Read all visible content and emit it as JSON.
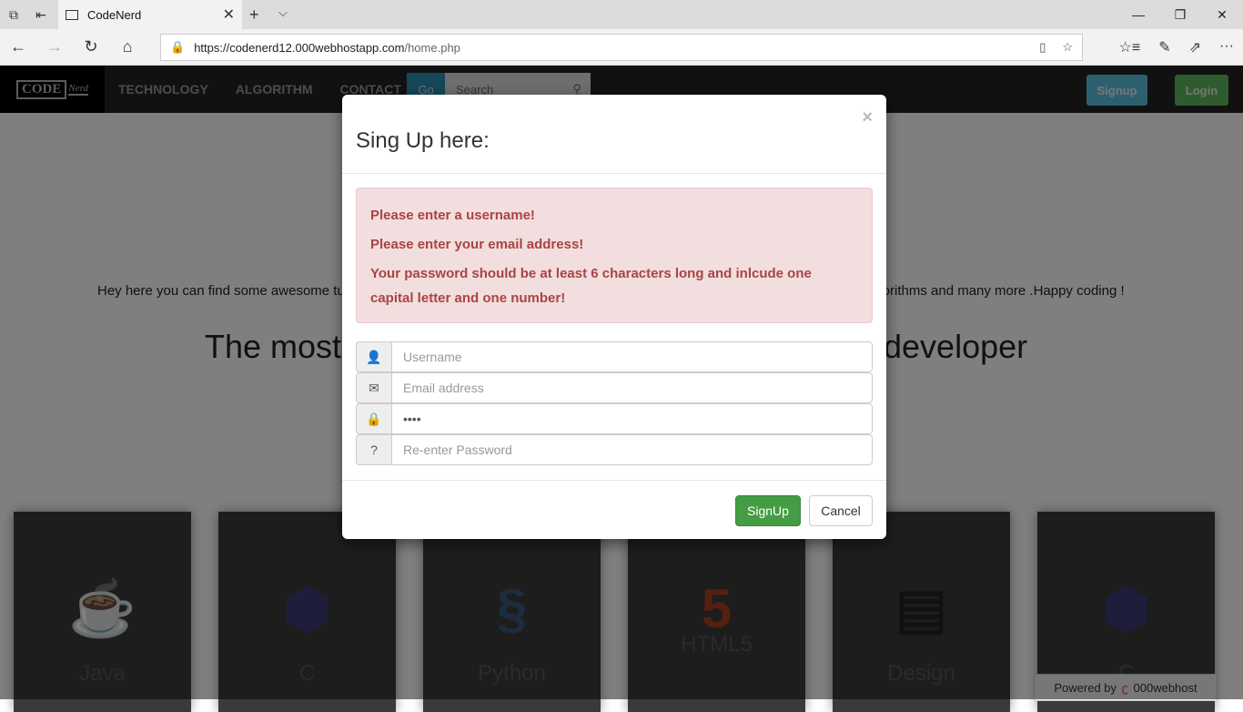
{
  "browser": {
    "tab_title": "CodeNerd",
    "url_host": "https://codenerd12.000webhostapp.com",
    "url_path": "/home.php"
  },
  "nav": {
    "logo": "CODE",
    "logo_sub": "Nerd",
    "links": [
      "TECHNOLOGY",
      "ALGORITHM",
      "CONTACT"
    ],
    "go": "Go",
    "search_placeholder": "Search",
    "signup": "Signup",
    "login": "Login"
  },
  "hero": {
    "intro_left": "Hey here you can find some awesome tu",
    "intro_right": "lgorithms and many more .Happy coding !",
    "heading_left": "The most",
    "heading_right": "developer"
  },
  "cards": [
    "Java",
    "C",
    "Python",
    "HTML5",
    "Design",
    "C"
  ],
  "footer_badge": {
    "powered": "Powered by",
    "brand": "000webhost"
  },
  "modal": {
    "title": "Sing Up here:",
    "close": "×",
    "errors": [
      "Please enter a username!",
      "Please enter your email address!",
      "Your password should be at least 6 characters long and inlcude one capital letter and one number!"
    ],
    "fields": {
      "username_ph": "Username",
      "email_ph": "Email address",
      "password_value": "1234",
      "repass_ph": "Re-enter Password"
    },
    "signup": "SignUp",
    "cancel": "Cancel"
  }
}
